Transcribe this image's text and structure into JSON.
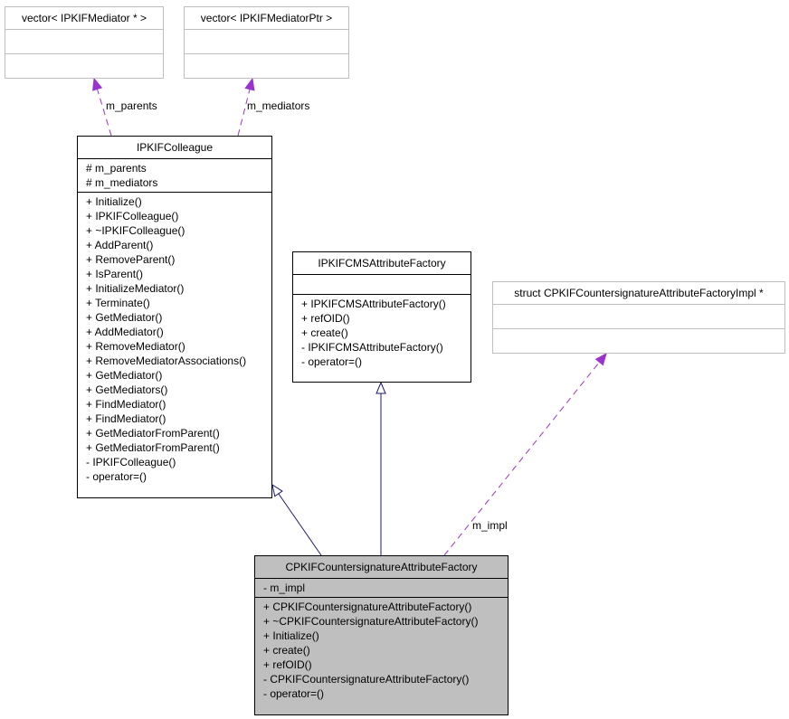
{
  "colors": {
    "inheritance": "#191970",
    "usage": "#9a32cd",
    "current_fill": "#bfbfbf",
    "external_border": "#bfbfbf"
  },
  "classes": {
    "vec_mediator": {
      "title": "vector< IPKIFMediator * >",
      "attrs": [],
      "methods": []
    },
    "vec_mediator_ptr": {
      "title": "vector< IPKIFMediatorPtr >",
      "attrs": [],
      "methods": []
    },
    "colleague": {
      "title": "IPKIFColleague",
      "attrs": [
        "# m_parents",
        "# m_mediators"
      ],
      "methods": [
        "+ Initialize()",
        "+ IPKIFColleague()",
        "+ ~IPKIFColleague()",
        "+ AddParent()",
        "+ RemoveParent()",
        "+ IsParent()",
        "+ InitializeMediator()",
        "+ Terminate()",
        "+ GetMediator()",
        "+ AddMediator()",
        "+ RemoveMediator()",
        "+ RemoveMediatorAssociations()",
        "+ GetMediator()",
        "+ GetMediators()",
        "+ FindMediator()",
        "+ FindMediator()",
        "+ GetMediatorFromParent()",
        "+ GetMediatorFromParent()",
        "- IPKIFColleague()",
        "- operator=()"
      ]
    },
    "cms_factory": {
      "title": "IPKIFCMSAttributeFactory",
      "attrs": [],
      "methods": [
        "+ IPKIFCMSAttributeFactory()",
        "+ refOID()",
        "+ create()",
        "- IPKIFCMSAttributeFactory()",
        "- operator=()"
      ]
    },
    "impl": {
      "title": "struct CPKIFCountersignatureAttributeFactoryImpl *",
      "attrs": [],
      "methods": []
    },
    "counter": {
      "title": "CPKIFCountersignatureAttributeFactory",
      "attrs": [
        "- m_impl"
      ],
      "methods": [
        "+ CPKIFCountersignatureAttributeFactory()",
        "+ ~CPKIFCountersignatureAttributeFactory()",
        "+ Initialize()",
        "+ create()",
        "+ refOID()",
        "- CPKIFCountersignatureAttributeFactory()",
        "- operator=()"
      ]
    }
  },
  "edges": [
    {
      "from": "colleague",
      "to": "vec_mediator",
      "kind": "usage",
      "label": "m_parents"
    },
    {
      "from": "colleague",
      "to": "vec_mediator_ptr",
      "kind": "usage",
      "label": "m_mediators"
    },
    {
      "from": "counter",
      "to": "colleague",
      "kind": "inheritance",
      "label": ""
    },
    {
      "from": "counter",
      "to": "cms_factory",
      "kind": "inheritance",
      "label": ""
    },
    {
      "from": "counter",
      "to": "impl",
      "kind": "usage",
      "label": "m_impl"
    }
  ]
}
